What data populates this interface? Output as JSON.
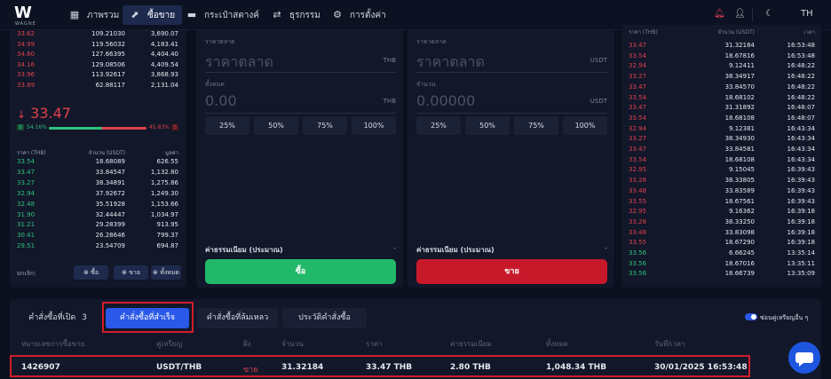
{
  "nav": {
    "logo_text": "W",
    "logo_sub": "WAGNE",
    "items": [
      {
        "label": "ภาพรวม",
        "icon": "dashboard-icon"
      },
      {
        "label": "ซื้อขาย",
        "icon": "chart-icon"
      },
      {
        "label": "กระเป๋าสตางค์",
        "icon": "wallet-icon"
      },
      {
        "label": "ธุรกรรม",
        "icon": "transfer-icon"
      },
      {
        "label": "การตั้งค่า",
        "icon": "gear-icon"
      }
    ],
    "lang": "TH"
  },
  "orderbook": {
    "asks": [
      {
        "price": "33.62",
        "amount": "109.21030",
        "total": "3,690.07"
      },
      {
        "price": "34.99",
        "amount": "119.56032",
        "total": "4,183.41"
      },
      {
        "price": "34.60",
        "amount": "127.66395",
        "total": "4,404.40"
      },
      {
        "price": "34.16",
        "amount": "129.08506",
        "total": "4,409.54"
      },
      {
        "price": "33.96",
        "amount": "113.92617",
        "total": "3,868.93"
      },
      {
        "price": "33.89",
        "amount": "62.88117",
        "total": "2,131.04"
      }
    ],
    "last_price": "33.47",
    "buy_label": "B",
    "buy_pct": "54.16%",
    "sell_pct": "45.83%",
    "sell_label": "S",
    "buy_ratio": 0.5416,
    "headers": {
      "price": "ราคา (THB)",
      "amount": "จำนวน (USDT)",
      "total": "มูลค่า"
    },
    "bids": [
      {
        "price": "33.54",
        "amount": "18.68089",
        "total": "626.55"
      },
      {
        "price": "33.47",
        "amount": "33.84547",
        "total": "1,132.80"
      },
      {
        "price": "33.27",
        "amount": "38.34891",
        "total": "1,275.86"
      },
      {
        "price": "32.94",
        "amount": "37.92672",
        "total": "1,249.30"
      },
      {
        "price": "32.48",
        "amount": "35.51928",
        "total": "1,153.66"
      },
      {
        "price": "31.90",
        "amount": "32.44447",
        "total": "1,034.97"
      },
      {
        "price": "31.21",
        "amount": "29.28399",
        "total": "913.95"
      },
      {
        "price": "30.41",
        "amount": "26.28646",
        "total": "799.37"
      },
      {
        "price": "29.51",
        "amount": "23.54709",
        "total": "694.87"
      }
    ],
    "cancel_label": "ยกเลิก:",
    "cancel_buy": "ซื้อ",
    "cancel_sell": "ขาย",
    "cancel_all": "ทั้งหมด"
  },
  "buy_form": {
    "price_label": "ราคาตลาด",
    "price_placeholder": "ราคาตลาด",
    "price_unit": "THB",
    "total_label": "ทั้งหมด",
    "total_value": "0.00",
    "total_unit": "THB",
    "pcts": [
      "25%",
      "50%",
      "75%",
      "100%"
    ],
    "fee_label": "ค่าธรรมเนียม (ประมาณ)",
    "fee_value": "-",
    "button": "ซื้อ"
  },
  "sell_form": {
    "price_label": "ราคาตลาด",
    "price_placeholder": "ราคาตลาด",
    "price_unit": "USDT",
    "amount_label": "จำนวน",
    "amount_value": "0.00000",
    "amount_unit": "USDT",
    "pcts": [
      "25%",
      "50%",
      "75%",
      "100%"
    ],
    "fee_label": "ค่าธรรมเนียม (ประมาณ)",
    "fee_value": "-",
    "button": "ขาย"
  },
  "trades": {
    "headers": {
      "price": "ราคา (THB)",
      "amount": "จำนวน (USDT)",
      "time": "เวลา"
    },
    "rows": [
      {
        "price": "33.47",
        "amount": "31.32184",
        "time": "16:53:48",
        "side": "red"
      },
      {
        "price": "33.54",
        "amount": "18.67816",
        "time": "16:53:48",
        "side": "red"
      },
      {
        "price": "32.94",
        "amount": "9.12411",
        "time": "16:48:22",
        "side": "red"
      },
      {
        "price": "33.27",
        "amount": "38.34917",
        "time": "16:48:22",
        "side": "red"
      },
      {
        "price": "33.47",
        "amount": "33.84570",
        "time": "16:48:22",
        "side": "red"
      },
      {
        "price": "33.54",
        "amount": "18.68102",
        "time": "16:48:22",
        "side": "red"
      },
      {
        "price": "33.47",
        "amount": "31.31892",
        "time": "16:48:07",
        "side": "red"
      },
      {
        "price": "33.54",
        "amount": "18.68108",
        "time": "16:48:07",
        "side": "red"
      },
      {
        "price": "32.94",
        "amount": "9.12381",
        "time": "16:43:34",
        "side": "red"
      },
      {
        "price": "33.27",
        "amount": "38.34930",
        "time": "16:43:34",
        "side": "red"
      },
      {
        "price": "33.47",
        "amount": "33.84581",
        "time": "16:43:34",
        "side": "red"
      },
      {
        "price": "33.54",
        "amount": "18.68108",
        "time": "16:43:34",
        "side": "red"
      },
      {
        "price": "32.95",
        "amount": "9.15045",
        "time": "16:39:43",
        "side": "red"
      },
      {
        "price": "33.28",
        "amount": "38.33805",
        "time": "16:39:43",
        "side": "red"
      },
      {
        "price": "33.48",
        "amount": "33.83589",
        "time": "16:39:43",
        "side": "red"
      },
      {
        "price": "33.55",
        "amount": "18.67561",
        "time": "16:39:43",
        "side": "red"
      },
      {
        "price": "32.95",
        "amount": "9.16362",
        "time": "16:39:18",
        "side": "red"
      },
      {
        "price": "33.28",
        "amount": "38.33250",
        "time": "16:39:18",
        "side": "red"
      },
      {
        "price": "33.48",
        "amount": "33.83098",
        "time": "16:39:18",
        "side": "red"
      },
      {
        "price": "33.55",
        "amount": "18.67290",
        "time": "16:39:18",
        "side": "red"
      },
      {
        "price": "33.56",
        "amount": "6.66245",
        "time": "13:35:14",
        "side": "green"
      },
      {
        "price": "33.56",
        "amount": "18.67016",
        "time": "13:35:11",
        "side": "green"
      },
      {
        "price": "33.56",
        "amount": "18.66739",
        "time": "13:35:09",
        "side": "green"
      }
    ]
  },
  "orders": {
    "tabs": [
      {
        "label": "คำสั่งซื้อที่เปิด",
        "count": "3"
      },
      {
        "label": "คำสั่งซื้อที่สำเร็จ"
      },
      {
        "label": "คำสั่งซื้อที่ล้มเหลว"
      },
      {
        "label": "ประวัติคำสั่งซื้อ"
      }
    ],
    "toggle_label": "ซ่อนคู่เหรียญอื่น ๆ",
    "headers": [
      "หมายเลขการซื้อขาย",
      "คู่เหรียญ",
      "ฝั่ง",
      "จำนวน",
      "ราคา",
      "ค่าธรรมเนียม",
      "ทั้งหมด",
      "วันที่/เวลา"
    ],
    "row": {
      "id": "1426907",
      "pair": "USDT/THB",
      "side": "ขาย",
      "amount": "31.32184",
      "price": "33.47 THB",
      "fee": "2.80 THB",
      "total": "1,048.34 THB",
      "datetime": "30/01/2025 16:53:48"
    }
  }
}
